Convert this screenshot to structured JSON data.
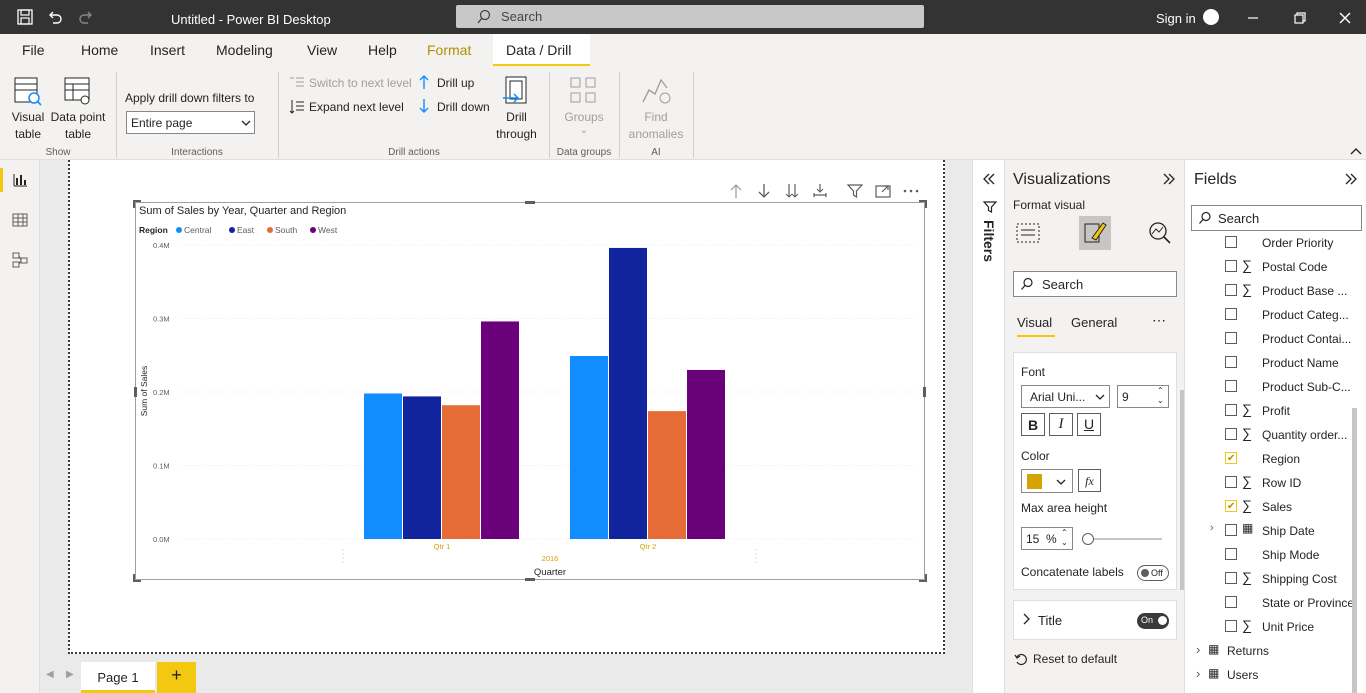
{
  "titlebar": {
    "title": "Untitled - Power BI Desktop",
    "search_placeholder": "Search",
    "sign_in": "Sign in"
  },
  "ribbon_tabs": [
    "File",
    "Home",
    "Insert",
    "Modeling",
    "View",
    "Help",
    "Format",
    "Data / Drill"
  ],
  "ribbon": {
    "show": {
      "visual_table": [
        "Visual",
        "table"
      ],
      "data_point_table": [
        "Data point",
        "table"
      ],
      "group": "Show"
    },
    "interactions": {
      "label": "Apply drill down filters to",
      "select_value": "Entire page",
      "group": "Interactions"
    },
    "drill_actions": {
      "switch_next_level": "Switch to next level",
      "expand_next_level": "Expand next level",
      "drill_up": "Drill up",
      "drill_down": "Drill down",
      "drill_through": [
        "Drill",
        "through"
      ],
      "group": "Drill actions"
    },
    "data_groups": {
      "groups": "Groups",
      "group": "Data groups"
    },
    "ai": {
      "find_anomalies": [
        "Find",
        "anomalies"
      ],
      "group": "AI"
    }
  },
  "chart_data": {
    "type": "bar",
    "title": "Sum of Sales by Year, Quarter and Region",
    "legend_title": "Region",
    "legend_placement": "top-left",
    "categories": [
      "Qtr 1",
      "Qtr 2"
    ],
    "category_group": "2016",
    "xlabel": "Quarter",
    "ylabel": "Sum of Sales",
    "ylim": [
      0,
      400000
    ],
    "yticks": [
      "0.0M",
      "0.1M",
      "0.2M",
      "0.3M",
      "0.4M"
    ],
    "grid": true,
    "series": [
      {
        "name": "Central",
        "color": "#118dff",
        "values": [
          198000,
          249000
        ]
      },
      {
        "name": "East",
        "color": "#12239e",
        "values": [
          194000,
          396000
        ]
      },
      {
        "name": "South",
        "color": "#e66c37",
        "values": [
          182000,
          174000
        ]
      },
      {
        "name": "West",
        "color": "#6b007b",
        "values": [
          296000,
          230000
        ]
      }
    ]
  },
  "filters": {
    "label": "Filters"
  },
  "visualizations": {
    "title": "Visualizations",
    "format_visual": "Format visual",
    "search_placeholder": "Search",
    "tabs": [
      "Visual",
      "General"
    ],
    "font_label": "Font",
    "font_family": "Arial Uni...",
    "font_size": "9",
    "bold": "B",
    "italic": "I",
    "underline": "U",
    "color_label": "Color",
    "color_value": "#d4a300",
    "fx": "fx",
    "max_area_label": "Max area height",
    "max_area_value": "15",
    "max_area_unit": "%",
    "max_area_slider": 0.0,
    "concat_label": "Concatenate labels",
    "concat_toggle": "Off",
    "title_section": "Title",
    "title_toggle": "On",
    "reset": "Reset to default"
  },
  "fields": {
    "title": "Fields",
    "search_placeholder": "Search",
    "items": [
      {
        "label": "Order Priority",
        "sigma": false,
        "checked": false
      },
      {
        "label": "Postal Code",
        "sigma": true,
        "checked": false
      },
      {
        "label": "Product Base ...",
        "sigma": true,
        "checked": false
      },
      {
        "label": "Product Categ...",
        "sigma": false,
        "checked": false
      },
      {
        "label": "Product Contai...",
        "sigma": false,
        "checked": false
      },
      {
        "label": "Product Name",
        "sigma": false,
        "checked": false
      },
      {
        "label": "Product Sub-C...",
        "sigma": false,
        "checked": false
      },
      {
        "label": "Profit",
        "sigma": true,
        "checked": false
      },
      {
        "label": "Quantity order...",
        "sigma": true,
        "checked": false
      },
      {
        "label": "Region",
        "sigma": false,
        "checked": true
      },
      {
        "label": "Row ID",
        "sigma": true,
        "checked": false
      },
      {
        "label": "Sales",
        "sigma": true,
        "checked": true
      },
      {
        "label": "Ship Date",
        "sigma": false,
        "checked": false
      },
      {
        "label": "Ship Mode",
        "sigma": false,
        "checked": false
      },
      {
        "label": "Shipping Cost",
        "sigma": true,
        "checked": false
      },
      {
        "label": "State or Province",
        "sigma": false,
        "checked": false
      },
      {
        "label": "Unit Price",
        "sigma": true,
        "checked": false
      }
    ],
    "tables": [
      "Returns",
      "Users"
    ]
  },
  "pages": {
    "tab": "Page 1",
    "add": "+"
  }
}
